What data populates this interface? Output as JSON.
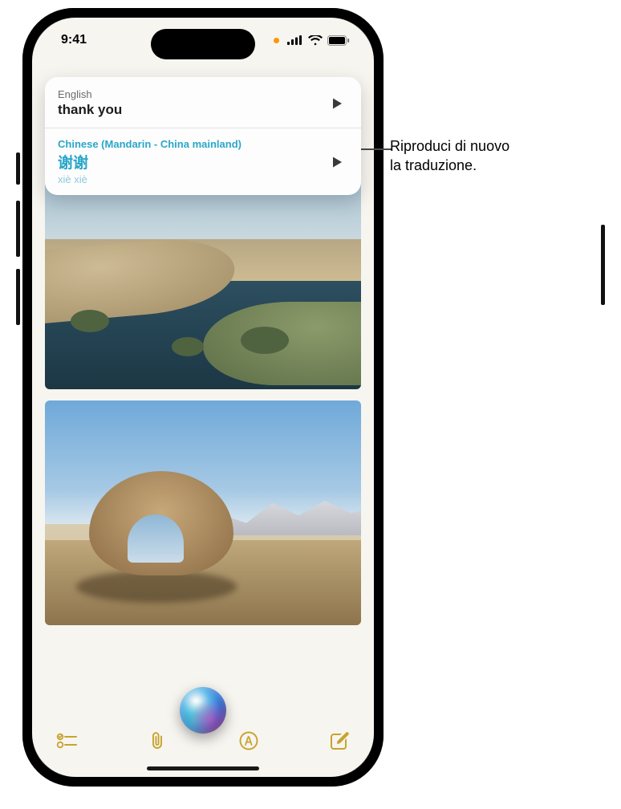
{
  "status": {
    "time": "9:41"
  },
  "translation": {
    "source_lang": "English",
    "source_text": "thank you",
    "target_lang": "Chinese (Mandarin - China mainland)",
    "target_text": "谢谢",
    "target_romanization": "xiè xiè"
  },
  "callout": {
    "line1": "Riproduci di nuovo",
    "line2": "la traduzione."
  }
}
